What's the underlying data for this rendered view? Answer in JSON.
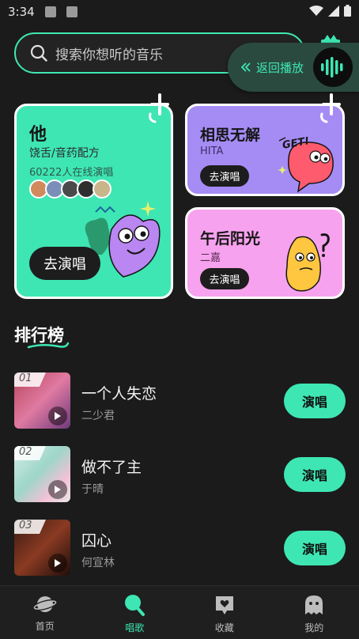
{
  "status_bar": {
    "time": "3:34"
  },
  "search": {
    "placeholder": "搜索你想听的音乐"
  },
  "back_play": {
    "label": "返回播放"
  },
  "cards": {
    "big": {
      "title": "他",
      "subtitle": "饶舌/音药配方",
      "online": "60222人在线演唱",
      "action": "去演唱"
    },
    "small1": {
      "title": "相思无解",
      "artist": "HITA",
      "action": "去演唱"
    },
    "small2": {
      "title": "午后阳光",
      "artist": "二嘉",
      "action": "去演唱"
    }
  },
  "ranking": {
    "title": "排行榜",
    "rows": [
      {
        "rank": "01",
        "song": "一个人失恋",
        "artist": "二少君",
        "action": "演唱"
      },
      {
        "rank": "02",
        "song": "做不了主",
        "artist": "于晴",
        "action": "演唱"
      },
      {
        "rank": "03",
        "song": "囚心",
        "artist": "何宣林",
        "action": "演唱"
      }
    ]
  },
  "nav": [
    {
      "label": "首页"
    },
    {
      "label": "唱歌"
    },
    {
      "label": "收藏"
    },
    {
      "label": "我的"
    }
  ],
  "colors": {
    "accent": "#3ee6b3",
    "card_green": "#3ee6b3",
    "card_purple": "#a58cf5",
    "card_pink": "#f7a2ee",
    "background": "#1b1b1b"
  },
  "icons": [
    "search-icon",
    "gift-icon",
    "double-chevron-left-icon",
    "waveform-icon",
    "play-icon",
    "planet-icon",
    "mic-icon",
    "heart-chat-icon",
    "ghost-icon"
  ]
}
